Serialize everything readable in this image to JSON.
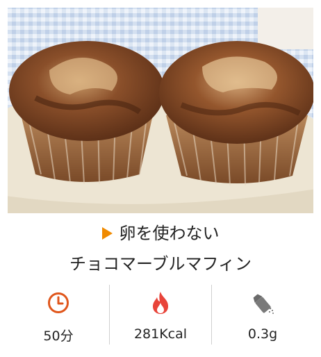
{
  "recipe": {
    "title_line1": "卵を使わない",
    "title_line2": "チョコマーブルマフィン"
  },
  "stats": {
    "time": "50分",
    "calories": "281Kcal",
    "salt": "0.3g"
  },
  "colors": {
    "accent": "#f08a00",
    "clock": "#e0561b",
    "flame": "#e8443a",
    "salt_shaker": "#7a7a7a"
  },
  "icons": {
    "title": "play-triangle-icon",
    "time": "clock-icon",
    "calories": "flame-icon",
    "salt": "salt-shaker-icon"
  }
}
